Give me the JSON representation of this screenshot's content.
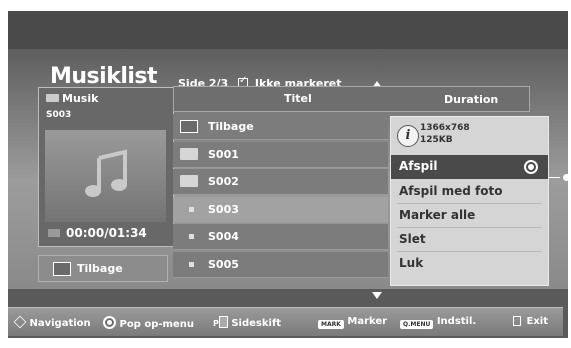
{
  "title": "Musiklist",
  "page_info": {
    "label": "Side 2/3",
    "filter": "Ikke markeret"
  },
  "left_panel": {
    "folder": "Musik",
    "selected": "S003",
    "time": "00:00/01:34",
    "back_label": "Tilbage"
  },
  "table": {
    "col_title": "Titel",
    "col_duration": "Duration",
    "rows": [
      {
        "label": "Tilbage",
        "icon": "back-icon"
      },
      {
        "label": "S001",
        "icon": "folder-icon"
      },
      {
        "label": "S002",
        "icon": "folder-icon"
      },
      {
        "label": "S003",
        "icon": "file-icon"
      },
      {
        "label": "S004",
        "icon": "file-icon"
      },
      {
        "label": "S005",
        "icon": "file-icon"
      }
    ]
  },
  "popup": {
    "resolution": "1366x768",
    "size": "125KB",
    "items": [
      "Afspil",
      "Afspil med foto",
      "Marker alle",
      "Slet",
      "Luk"
    ]
  },
  "bottom_bar": {
    "navigation": "Navigation",
    "popup_menu": "Pop op-menu",
    "page_key": "P",
    "page_shift": "Sideskift",
    "mark_key": "MARK",
    "mark": "Marker",
    "qmenu_key": "Q.MENU",
    "settings": "Indstil.",
    "exit": "Exit"
  },
  "colors": {
    "screen_bg": "#5a5a5a",
    "highlight": "#4a4a4a",
    "popup_bg": "#d5d5d5"
  }
}
